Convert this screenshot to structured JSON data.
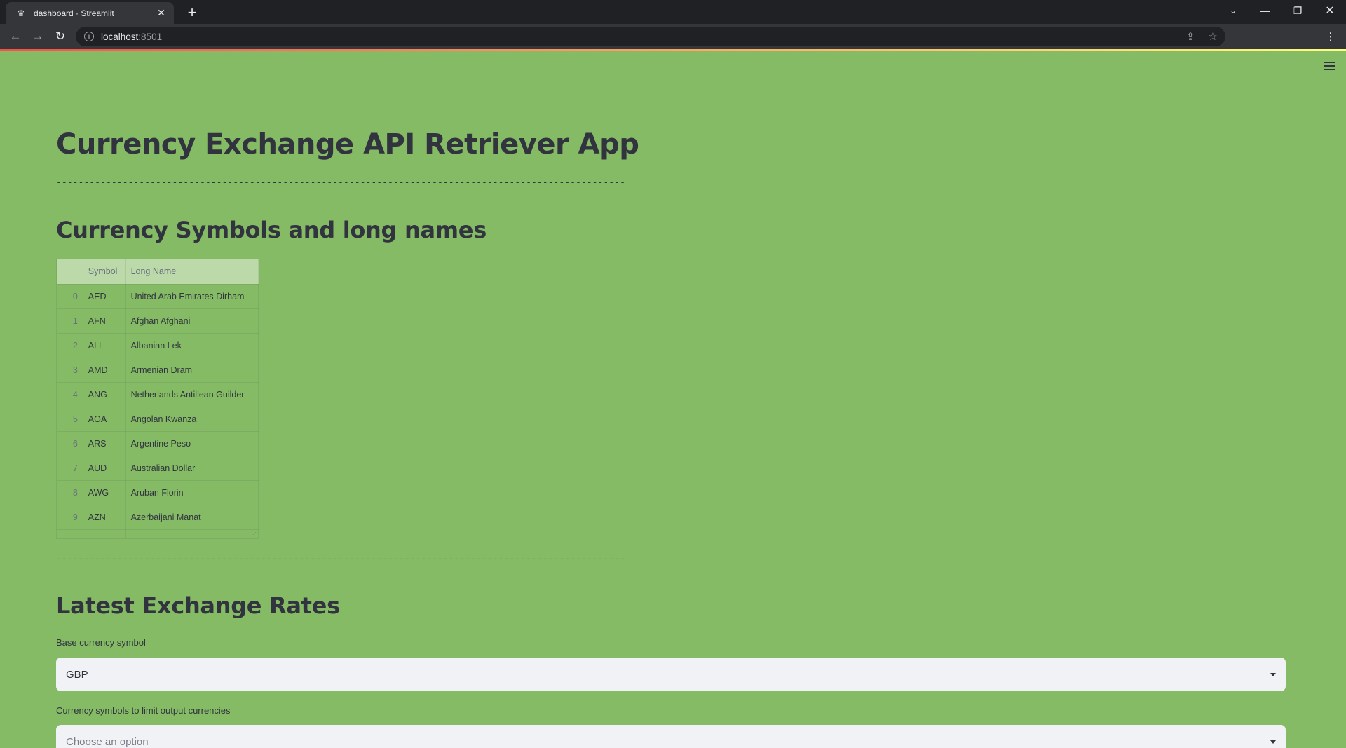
{
  "browser": {
    "tab_title": "dashboard · Streamlit",
    "url_host": "localhost",
    "url_port": ":8501"
  },
  "page": {
    "title": "Currency Exchange API Retriever App",
    "divider": "-------------------------------------------------------------------------------------------------------"
  },
  "symbols_section": {
    "title": "Currency Symbols and long names",
    "columns": [
      "",
      "Symbol",
      "Long Name"
    ],
    "rows": [
      {
        "index": "0",
        "symbol": "AED",
        "name": "United Arab Emirates Dirham"
      },
      {
        "index": "1",
        "symbol": "AFN",
        "name": "Afghan Afghani"
      },
      {
        "index": "2",
        "symbol": "ALL",
        "name": "Albanian Lek"
      },
      {
        "index": "3",
        "symbol": "AMD",
        "name": "Armenian Dram"
      },
      {
        "index": "4",
        "symbol": "ANG",
        "name": "Netherlands Antillean Guilder"
      },
      {
        "index": "5",
        "symbol": "AOA",
        "name": "Angolan Kwanza"
      },
      {
        "index": "6",
        "symbol": "ARS",
        "name": "Argentine Peso"
      },
      {
        "index": "7",
        "symbol": "AUD",
        "name": "Australian Dollar"
      },
      {
        "index": "8",
        "symbol": "AWG",
        "name": "Aruban Florin"
      },
      {
        "index": "9",
        "symbol": "AZN",
        "name": "Azerbaijani Manat"
      }
    ]
  },
  "rates_section": {
    "title": "Latest Exchange Rates",
    "base_label": "Base currency symbol",
    "base_value": "GBP",
    "symbols_label": "Currency symbols to limit output currencies",
    "symbols_placeholder": "Choose an option"
  },
  "colors": {
    "background": "#85bb65",
    "text": "#31333f",
    "input_bg": "#f0f2f6"
  }
}
